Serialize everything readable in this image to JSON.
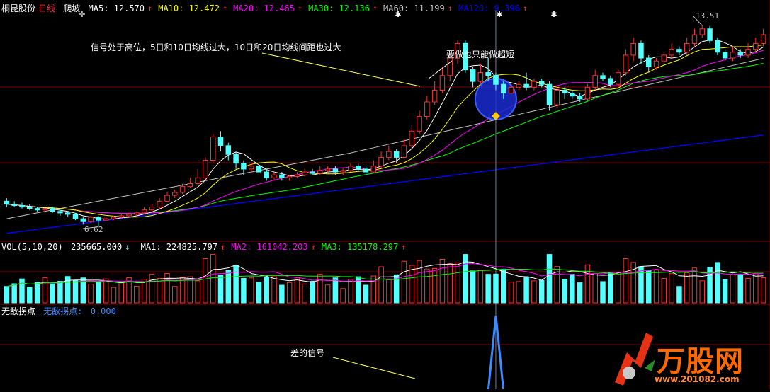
{
  "header": {
    "stock_name": "桐昆股份",
    "period": "日线",
    "indicator": "爬坡",
    "ma": [
      {
        "label": "MA5:",
        "value": "12.570",
        "arrow": "↑",
        "color": "#ffffff"
      },
      {
        "label": "MA10:",
        "value": "12.472",
        "arrow": "↑",
        "color": "#ffff00"
      },
      {
        "label": "MA20:",
        "value": "12.465",
        "arrow": "↑",
        "color": "#ff00ff"
      },
      {
        "label": "MA30:",
        "value": "12.136",
        "arrow": "↑",
        "color": "#00ff00"
      },
      {
        "label": "MA60:",
        "value": "11.199",
        "arrow": "↑",
        "color": "#c0c0c0"
      },
      {
        "label": "MA120:",
        "value": "9.396",
        "arrow": "↑",
        "color": "#0000ff"
      }
    ]
  },
  "vol_header": {
    "label": "VOL(5,10,20)",
    "value": "235665.000",
    "value_arrow": "↓",
    "mas": [
      {
        "label": "MA1:",
        "value": "224825.797",
        "arrow": "↑",
        "color": "#ffffff"
      },
      {
        "label": "MA2:",
        "value": "161042.203",
        "arrow": "↑",
        "color": "#ff00ff"
      },
      {
        "label": "MA3:",
        "value": "135178.297",
        "arrow": "↑",
        "color": "#00ff00"
      }
    ]
  },
  "sig_header": {
    "title": "无敌拐点",
    "name": "无敌拐点:",
    "value": "0.000"
  },
  "annotations": {
    "high_label": "13.51",
    "low_label": "6.62",
    "note1": "信号处于高位，5日和10日均线过大，10日和20日均线间距也过大",
    "note2": "要做也只能做超短",
    "note3": "差的信号"
  },
  "watermark": {
    "brand": "万股网",
    "url": "www.201082.com"
  },
  "colors": {
    "up": "#ff3232",
    "down": "#54ffff",
    "grid": "#800000",
    "ma5": "#ffffff",
    "ma10": "#ffff00",
    "ma20": "#ff00ff",
    "ma30": "#00ff00",
    "ma60": "#c0c0c0",
    "ma120": "#0000ff",
    "signal": "#3c8cff"
  },
  "chart_data": {
    "type": "candlestick",
    "price_range": [
      6.2,
      14.0
    ],
    "high_marker": 13.51,
    "low_marker": 6.62,
    "candles": [
      [
        7.5,
        7.4,
        7.6,
        7.3
      ],
      [
        7.4,
        7.35,
        7.5,
        7.3
      ],
      [
        7.35,
        7.3,
        7.45,
        7.25
      ],
      [
        7.3,
        7.25,
        7.4,
        7.2
      ],
      [
        7.25,
        7.2,
        7.3,
        7.15
      ],
      [
        7.2,
        7.25,
        7.3,
        7.1
      ],
      [
        7.25,
        7.15,
        7.3,
        7.1
      ],
      [
        7.15,
        7.1,
        7.2,
        7.0
      ],
      [
        7.1,
        7.05,
        7.15,
        6.95
      ],
      [
        7.05,
        6.9,
        7.1,
        6.85
      ],
      [
        6.9,
        6.8,
        6.95,
        6.7
      ],
      [
        6.8,
        6.95,
        7.0,
        6.75
      ],
      [
        6.95,
        6.85,
        7.0,
        6.62
      ],
      [
        6.85,
        6.9,
        6.95,
        6.8
      ],
      [
        6.9,
        6.95,
        7.0,
        6.85
      ],
      [
        6.95,
        7.0,
        7.05,
        6.9
      ],
      [
        7.0,
        7.05,
        7.1,
        6.95
      ],
      [
        7.05,
        7.1,
        7.15,
        7.0
      ],
      [
        7.1,
        7.2,
        7.3,
        7.05
      ],
      [
        7.2,
        7.3,
        7.4,
        7.15
      ],
      [
        7.3,
        7.5,
        7.6,
        7.25
      ],
      [
        7.5,
        7.7,
        7.8,
        7.45
      ],
      [
        7.7,
        7.8,
        7.9,
        7.6
      ],
      [
        7.8,
        8.0,
        8.1,
        7.75
      ],
      [
        8.0,
        8.1,
        8.3,
        7.95
      ],
      [
        8.1,
        8.3,
        8.6,
        8.05
      ],
      [
        8.3,
        8.9,
        9.0,
        8.2
      ],
      [
        8.9,
        9.7,
        9.8,
        8.8
      ],
      [
        9.7,
        9.4,
        9.9,
        9.2
      ],
      [
        9.4,
        9.1,
        9.5,
        8.9
      ],
      [
        9.1,
        8.8,
        9.2,
        8.6
      ],
      [
        8.8,
        8.6,
        8.9,
        8.4
      ],
      [
        8.6,
        8.7,
        8.8,
        8.5
      ],
      [
        8.7,
        8.5,
        8.8,
        8.4
      ],
      [
        8.5,
        8.3,
        8.6,
        8.2
      ],
      [
        8.3,
        8.4,
        8.5,
        8.2
      ],
      [
        8.4,
        8.3,
        8.5,
        8.2
      ],
      [
        8.3,
        8.35,
        8.4,
        8.2
      ],
      [
        8.35,
        8.4,
        8.5,
        8.3
      ],
      [
        8.4,
        8.5,
        8.6,
        8.35
      ],
      [
        8.5,
        8.45,
        8.6,
        8.4
      ],
      [
        8.45,
        8.55,
        8.7,
        8.4
      ],
      [
        8.55,
        8.6,
        8.7,
        8.5
      ],
      [
        8.6,
        8.5,
        8.7,
        8.4
      ],
      [
        8.5,
        8.55,
        8.65,
        8.4
      ],
      [
        8.55,
        8.7,
        8.8,
        8.5
      ],
      [
        8.7,
        8.6,
        8.8,
        8.5
      ],
      [
        8.6,
        8.5,
        8.7,
        8.4
      ],
      [
        8.5,
        8.7,
        8.9,
        8.45
      ],
      [
        8.7,
        9.0,
        9.2,
        8.65
      ],
      [
        9.0,
        9.2,
        9.4,
        8.9
      ],
      [
        9.2,
        9.0,
        9.3,
        8.8
      ],
      [
        9.0,
        9.4,
        9.6,
        8.95
      ],
      [
        9.4,
        9.9,
        10.1,
        9.3
      ],
      [
        9.9,
        10.4,
        10.6,
        9.8
      ],
      [
        10.4,
        10.9,
        11.1,
        10.3
      ],
      [
        10.9,
        11.3,
        11.6,
        10.8
      ],
      [
        11.3,
        11.8,
        12.1,
        11.2
      ],
      [
        11.8,
        12.4,
        12.6,
        11.6
      ],
      [
        12.4,
        12.9,
        13.0,
        12.2
      ],
      [
        12.9,
        12.0,
        13.0,
        11.9
      ],
      [
        12.0,
        11.6,
        12.1,
        11.4
      ],
      [
        11.6,
        11.9,
        12.2,
        11.5
      ],
      [
        11.9,
        11.8,
        12.4,
        11.6
      ],
      [
        11.8,
        11.5,
        11.9,
        11.3
      ],
      [
        11.5,
        11.2,
        11.6,
        11.0
      ],
      [
        11.2,
        11.4,
        11.5,
        11.1
      ],
      [
        11.4,
        11.5,
        11.6,
        11.3
      ],
      [
        11.5,
        11.4,
        11.9,
        11.3
      ],
      [
        11.4,
        11.6,
        11.7,
        11.3
      ],
      [
        11.6,
        11.5,
        11.7,
        11.4
      ],
      [
        11.5,
        10.8,
        11.6,
        10.6
      ],
      [
        10.8,
        11.3,
        11.4,
        10.7
      ],
      [
        11.3,
        11.2,
        11.4,
        11.0
      ],
      [
        11.2,
        11.1,
        11.3,
        11.0
      ],
      [
        11.1,
        11.0,
        11.2,
        10.9
      ],
      [
        11.0,
        11.4,
        11.5,
        10.9
      ],
      [
        11.4,
        11.8,
        12.0,
        11.3
      ],
      [
        11.8,
        11.7,
        11.9,
        11.6
      ],
      [
        11.7,
        11.5,
        11.8,
        11.4
      ],
      [
        11.5,
        11.9,
        12.0,
        11.4
      ],
      [
        11.9,
        12.5,
        12.7,
        11.8
      ],
      [
        12.5,
        12.9,
        13.1,
        12.3
      ],
      [
        12.9,
        12.4,
        13.0,
        12.2
      ],
      [
        12.4,
        12.1,
        12.5,
        11.9
      ],
      [
        12.1,
        12.3,
        12.4,
        12.0
      ],
      [
        12.3,
        12.5,
        12.6,
        12.2
      ],
      [
        12.5,
        12.7,
        12.9,
        12.4
      ],
      [
        12.7,
        12.6,
        12.8,
        12.5
      ],
      [
        12.6,
        12.9,
        13.1,
        12.5
      ],
      [
        12.9,
        13.2,
        13.4,
        12.8
      ],
      [
        13.2,
        13.4,
        13.51,
        13.1
      ],
      [
        13.4,
        13.0,
        13.5,
        12.9
      ],
      [
        13.0,
        12.6,
        13.1,
        12.5
      ],
      [
        12.6,
        12.4,
        12.7,
        12.3
      ],
      [
        12.4,
        12.6,
        12.8,
        12.3
      ],
      [
        12.6,
        12.5,
        12.7,
        12.4
      ],
      [
        12.5,
        12.7,
        12.9,
        12.4
      ],
      [
        12.7,
        12.9,
        13.1,
        12.6
      ],
      [
        12.9,
        13.2,
        13.4,
        12.8
      ]
    ],
    "signal_peak_index": 64,
    "signal_range": [
      0,
      1
    ]
  }
}
